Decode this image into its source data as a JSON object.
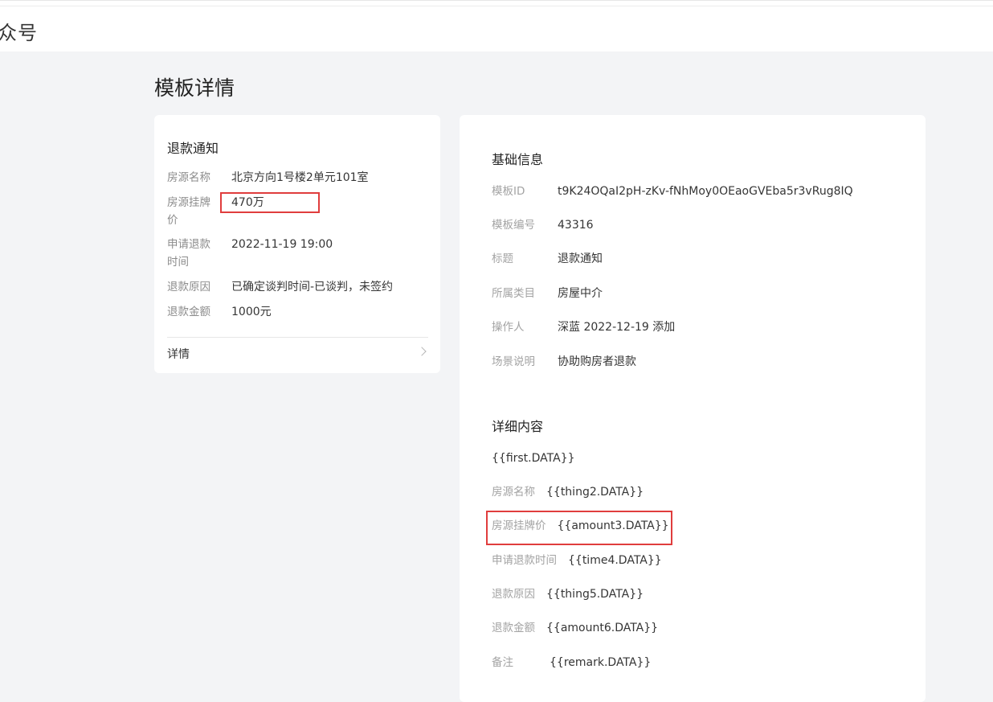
{
  "header": {
    "brand_fragment": "众号"
  },
  "page": {
    "title": "模板详情"
  },
  "preview_card": {
    "title": "退款通知",
    "fields": [
      {
        "label": "房源名称",
        "value": "北京方向1号楼2单元101室"
      },
      {
        "label_line1": "房源挂牌",
        "label_line2": "价",
        "value": "470万"
      },
      {
        "label_line1": "申请退款",
        "label_line2": "时间",
        "value": "2022-11-19 19:00"
      },
      {
        "label": "退款原因",
        "value": "已确定谈判时间-已谈判，未签约"
      },
      {
        "label": "退款金额",
        "value": "1000元"
      }
    ],
    "detail_link": "详情"
  },
  "basic_info": {
    "title": "基础信息",
    "rows": [
      {
        "label": "模板ID",
        "value": "t9K24OQaI2pH-zKv-fNhMoy0OEaoGVEba5r3vRug8IQ"
      },
      {
        "label": "模板编号",
        "value": "43316"
      },
      {
        "label": "标题",
        "value": "退款通知"
      },
      {
        "label": "所属类目",
        "value": "房屋中介"
      },
      {
        "label": "操作人",
        "value": "深蓝 2022-12-19 添加"
      },
      {
        "label": "场景说明",
        "value": "协助购房者退款"
      }
    ]
  },
  "detail_content": {
    "title": "详细内容",
    "first_line": "{{first.DATA}}",
    "rows": [
      {
        "label": "房源名称",
        "value": "{{thing2.DATA}}"
      },
      {
        "label": "房源挂牌价",
        "value": "{{amount3.DATA}}"
      },
      {
        "label": "申请退款时间",
        "value": "{{time4.DATA}}"
      },
      {
        "label": "退款原因",
        "value": "{{thing5.DATA}}"
      },
      {
        "label": "退款金额",
        "value": "{{amount6.DATA}}"
      },
      {
        "label": "备注",
        "value": "{{remark.DATA}}"
      }
    ]
  },
  "colors": {
    "highlight": "#e03d3d",
    "background": "#f3f4f6",
    "card": "#ffffff"
  }
}
